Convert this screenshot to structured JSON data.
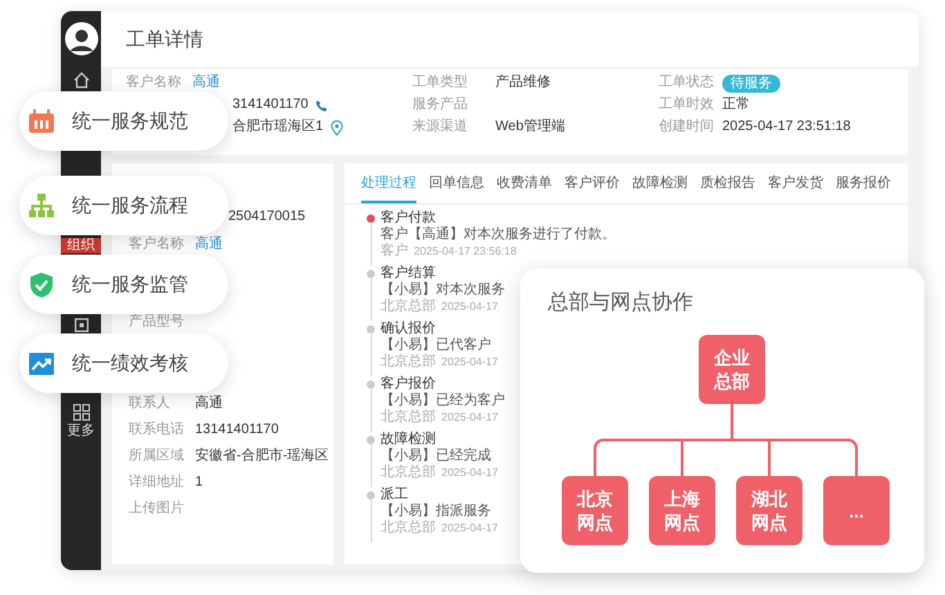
{
  "header": {
    "title": "工单详情"
  },
  "sidebar": {
    "items": [
      {
        "kind": "avatar"
      },
      {
        "kind": "home"
      },
      {
        "kind": "badge",
        "label": "组织",
        "selected": true
      },
      {
        "kind": "box"
      },
      {
        "kind": "more",
        "label": "更多"
      }
    ]
  },
  "info": {
    "columns": [
      {
        "fields": [
          {
            "label": "客户名称",
            "value": "高通",
            "kind": "link"
          },
          {
            "value": "3141401170",
            "kind": "phone"
          },
          {
            "value": "合肥市瑶海区1",
            "kind": "location"
          }
        ]
      },
      {
        "fields": [
          {
            "label": "工单类型",
            "value": "产品维修",
            "kind": "text"
          },
          {
            "label": "服务产品"
          },
          {
            "label": "来源渠道",
            "value": "Web管理端",
            "kind": "text"
          }
        ]
      },
      {
        "fields": [
          {
            "label": "工单状态",
            "value": "待服务",
            "kind": "badge"
          },
          {
            "label": "工单时效",
            "value": "正常",
            "kind": "text"
          },
          {
            "label": "创建时间",
            "value": "2025-04-17 23:51:18",
            "kind": "text"
          }
        ]
      }
    ]
  },
  "detail": {
    "rows": [
      {
        "value": "2504170015",
        "kind": "text"
      },
      {
        "label": "客户名称",
        "value": "高通",
        "kind": "link"
      },
      {
        "label": "产品型号"
      },
      {
        "label": "联系人",
        "value": "高通",
        "kind": "text"
      },
      {
        "label": "联系电话",
        "value": "13141401170",
        "kind": "text"
      },
      {
        "label": "所属区域",
        "value": "安徽省-合肥市-瑶海区",
        "kind": "text"
      },
      {
        "label": "详细地址",
        "value": "1",
        "kind": "text"
      },
      {
        "label": "上传图片"
      }
    ]
  },
  "tabs": [
    {
      "label": "处理过程",
      "selected": true
    },
    {
      "label": "回单信息",
      "selected": false
    },
    {
      "label": "收费清单",
      "selected": false
    },
    {
      "label": "客户评价",
      "selected": false
    },
    {
      "label": "故障检测",
      "selected": false
    },
    {
      "label": "质检报告",
      "selected": false
    },
    {
      "label": "客户发货",
      "selected": false
    },
    {
      "label": "服务报价",
      "selected": false
    }
  ],
  "timeline": [
    {
      "title": "客户付款",
      "text": "客户【高通】对本次服务进行了付款。",
      "source": "客户",
      "time": "2025-04-17 23:56:18",
      "active": true
    },
    {
      "title": "客户结算",
      "text": "【小易】对本次服务",
      "source": "北京总部",
      "time": "2025-04-17",
      "active": false
    },
    {
      "title": "确认报价",
      "text": "【小易】已代客户",
      "source": "北京总部",
      "time": "2025-04-17",
      "active": false
    },
    {
      "title": "客户报价",
      "text": "【小易】已经为客户",
      "source": "北京总部",
      "time": "2025-04-17",
      "active": false
    },
    {
      "title": "故障检测",
      "text": "【小易】已经完成",
      "source": "北京总部",
      "time": "2025-04-17",
      "active": false
    },
    {
      "title": "派工",
      "text": "【小易】指派服务",
      "source": "北京总部",
      "time": "2025-04-17",
      "active": false
    }
  ],
  "features": [
    {
      "kind": "spec",
      "label": "统一服务规范"
    },
    {
      "kind": "flow",
      "label": "统一服务流程"
    },
    {
      "kind": "supervise",
      "label": "统一服务监管"
    },
    {
      "kind": "performance",
      "label": "统一绩效考核"
    }
  ],
  "collaboration": {
    "title": "总部与网点协作",
    "root": {
      "label": "企业总部"
    },
    "branches": [
      {
        "label": "北京网点"
      },
      {
        "label": "上海网点"
      },
      {
        "label": "湖北网点"
      },
      {
        "label": "..."
      }
    ]
  }
}
